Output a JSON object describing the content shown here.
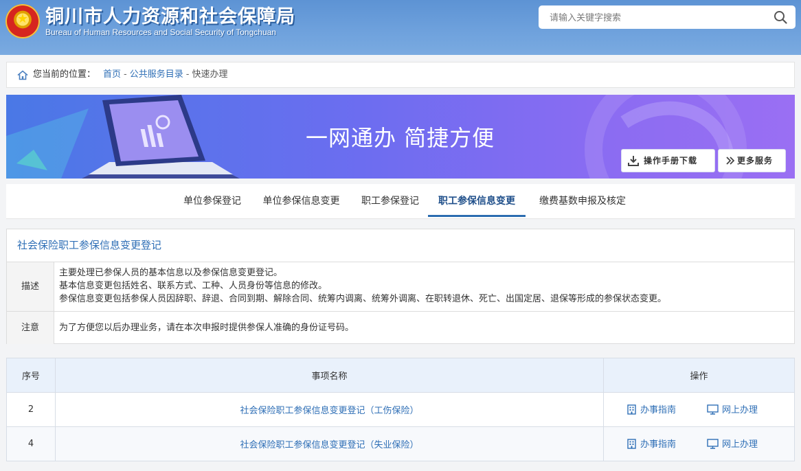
{
  "header": {
    "title": "铜川市人力资源和社会保障局",
    "subtitle": "Bureau of Human Resources and Social Security of Tongchuan",
    "search_placeholder": "请输入关键字搜索"
  },
  "breadcrumb": {
    "label": "您当前的位置：",
    "items": [
      "首页",
      "公共服务目录",
      "快速办理"
    ],
    "separator": "-"
  },
  "banner": {
    "title": "一网通办 简捷方便",
    "download_button": "操作手册下载",
    "more_button": "更多服务"
  },
  "tabs": [
    {
      "label": "单位参保登记",
      "active": false
    },
    {
      "label": "单位参保信息变更",
      "active": false
    },
    {
      "label": "职工参保登记",
      "active": false
    },
    {
      "label": "职工参保信息变更",
      "active": true
    },
    {
      "label": "缴费基数申报及核定",
      "active": false
    }
  ],
  "info": {
    "title": "社会保险职工参保信息变更登记",
    "description_label": "描述",
    "description_lines": [
      "主要处理已参保人员的基本信息以及参保信息变更登记。",
      "基本信息变更包括姓名、联系方式、工种、人员身份等信息的修改。",
      "参保信息变更包括参保人员因辞职、辞退、合同到期、解除合同、统筹内调离、统筹外调离、在职转退休、死亡、出国定居、退保等形成的参保状态变更。"
    ],
    "notice_label": "注意",
    "notice_text": "为了方便您以后办理业务，请在本次申报时提供参保人准确的身份证号码。"
  },
  "table": {
    "headers": [
      "序号",
      "事项名称",
      "操作"
    ],
    "rows": [
      {
        "num": "2",
        "name": "社会保险职工参保信息变更登记（工伤保险）",
        "guide": "办事指南",
        "online": "网上办理"
      },
      {
        "num": "4",
        "name": "社会保险职工参保信息变更登记（失业保险）",
        "guide": "办事指南",
        "online": "网上办理"
      }
    ]
  },
  "colors": {
    "header_blue": "#6a9edb",
    "link_blue": "#2f6fb6",
    "tab_active": "#1f4f8a",
    "banner_start": "#4a78e6",
    "banner_end": "#9a6ff3"
  }
}
